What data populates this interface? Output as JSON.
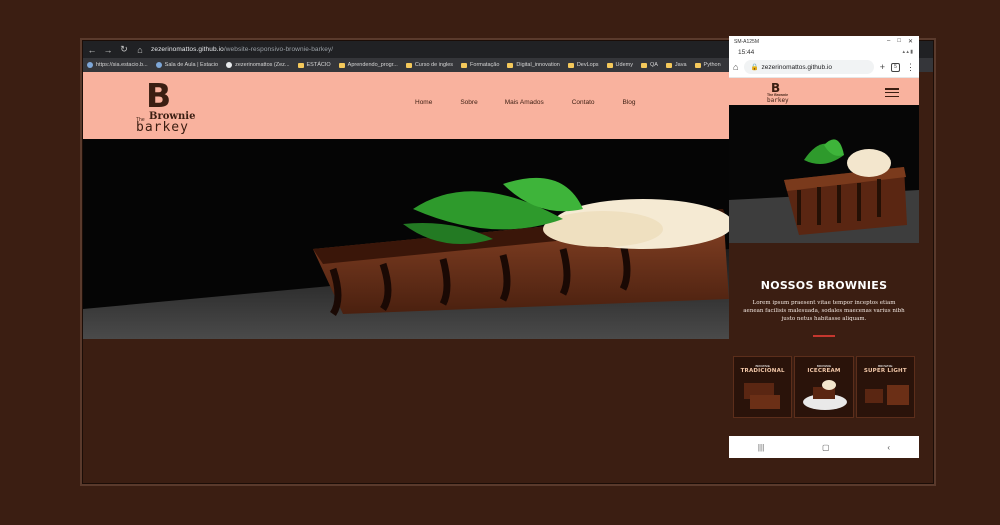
{
  "colors": {
    "brand_brown": "#3b1e12",
    "header_salmon": "#f9b29e",
    "accent_red": "#c5372e"
  },
  "desktop": {
    "url_host": "zezerinomattos.github.io",
    "url_path": "/website-responsivo-brownie-barkey/",
    "bookmarks": [
      "https://sia.estacio.b...",
      "Sala de Aula | Estacio",
      "zezerinomattos (Zez...",
      "ESTÁCIO",
      "Aprendendo_progr...",
      "Curso de ingles",
      "Formatação",
      "Digital_innovation",
      "DevLops",
      "Udemy",
      "QA",
      "Java",
      "Python"
    ],
    "site": {
      "logo": {
        "letter": "B",
        "the": "The",
        "brownie": "Brownie",
        "barkey": "barkey"
      },
      "menu": [
        "Home",
        "Sobre",
        "Mais Amados",
        "Contato",
        "Blog"
      ]
    }
  },
  "phone": {
    "device": "SM-A125M",
    "time": "15:44",
    "url": "zezerinomattos.github.io",
    "tab_count": "5",
    "logo": {
      "letter": "B",
      "the": "The",
      "brownie": "Brownie",
      "barkey": "barkey"
    },
    "section_title": "NOSSOS BROWNIES",
    "section_text": "Lorem ipsum praesent vitae tempor inceptos etiam aenean facilisis malesuada, sodales maecenas varius nibh justo netus habitasse aliquam.",
    "cards": [
      {
        "small": "BROWNIE",
        "name": "TRADICIONAL"
      },
      {
        "small": "BROWNIE",
        "name": "ICECREAM"
      },
      {
        "small": "BROWNIE",
        "name": "SUPER LIGHT"
      }
    ]
  }
}
